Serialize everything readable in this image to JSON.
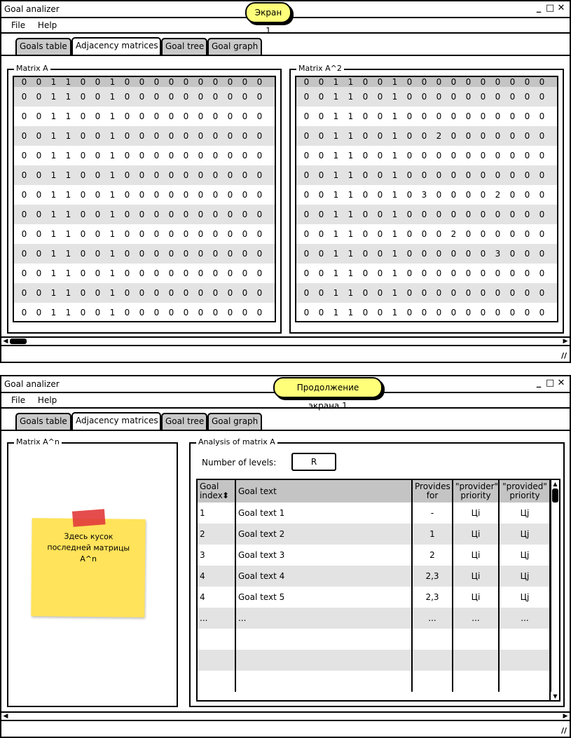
{
  "screen1": {
    "title": "Goal analizer",
    "sticky_label": "Экран 1",
    "controls": {
      "minimize": "_",
      "maximize": "□",
      "close": "✕"
    },
    "menu": {
      "file": "File",
      "help": "Help"
    },
    "tabs": [
      "Goals table",
      "Adjacency matrices",
      "Goal tree",
      "Goal graph"
    ],
    "matrix_a": {
      "legend": "Matrix A",
      "rows": [
        [
          "0",
          "0",
          "1",
          "1",
          "0",
          "0",
          "1",
          "0",
          "0",
          "0",
          "0",
          "0",
          "0",
          "0",
          "0",
          "0",
          "0"
        ],
        [
          "0",
          "0",
          "1",
          "1",
          "0",
          "0",
          "1",
          "0",
          "0",
          "0",
          "0",
          "0",
          "0",
          "0",
          "0",
          "0",
          "0"
        ],
        [
          "0",
          "0",
          "1",
          "1",
          "0",
          "0",
          "1",
          "0",
          "0",
          "0",
          "0",
          "0",
          "0",
          "0",
          "0",
          "0",
          "0"
        ],
        [
          "0",
          "0",
          "1",
          "1",
          "0",
          "0",
          "1",
          "0",
          "0",
          "0",
          "0",
          "0",
          "0",
          "0",
          "0",
          "0",
          "0"
        ],
        [
          "0",
          "0",
          "1",
          "1",
          "0",
          "0",
          "1",
          "0",
          "0",
          "0",
          "0",
          "0",
          "0",
          "0",
          "0",
          "0",
          "0"
        ],
        [
          "0",
          "0",
          "1",
          "1",
          "0",
          "0",
          "1",
          "0",
          "0",
          "0",
          "0",
          "0",
          "0",
          "0",
          "0",
          "0",
          "0"
        ],
        [
          "0",
          "0",
          "1",
          "1",
          "0",
          "0",
          "1",
          "0",
          "0",
          "0",
          "0",
          "0",
          "0",
          "0",
          "0",
          "0",
          "0"
        ],
        [
          "0",
          "0",
          "1",
          "1",
          "0",
          "0",
          "1",
          "0",
          "0",
          "0",
          "0",
          "0",
          "0",
          "0",
          "0",
          "0",
          "0"
        ],
        [
          "0",
          "0",
          "1",
          "1",
          "0",
          "0",
          "1",
          "0",
          "0",
          "0",
          "0",
          "0",
          "0",
          "0",
          "0",
          "0",
          "0"
        ],
        [
          "0",
          "0",
          "1",
          "1",
          "0",
          "0",
          "1",
          "0",
          "0",
          "0",
          "0",
          "0",
          "0",
          "0",
          "0",
          "0",
          "0"
        ],
        [
          "0",
          "0",
          "1",
          "1",
          "0",
          "0",
          "1",
          "0",
          "0",
          "0",
          "0",
          "0",
          "0",
          "0",
          "0",
          "0",
          "0"
        ],
        [
          "0",
          "0",
          "1",
          "1",
          "0",
          "0",
          "1",
          "0",
          "0",
          "0",
          "0",
          "0",
          "0",
          "0",
          "0",
          "0",
          "0"
        ],
        [
          "0",
          "0",
          "1",
          "1",
          "0",
          "0",
          "1",
          "0",
          "0",
          "0",
          "0",
          "0",
          "0",
          "0",
          "0",
          "0",
          "0"
        ]
      ]
    },
    "matrix_a2": {
      "legend": "Matrix A^2",
      "rows": [
        [
          "0",
          "0",
          "1",
          "1",
          "0",
          "0",
          "1",
          "0",
          "0",
          "0",
          "0",
          "0",
          "0",
          "0",
          "0",
          "0",
          "0"
        ],
        [
          "0",
          "0",
          "1",
          "1",
          "0",
          "0",
          "1",
          "0",
          "0",
          "0",
          "0",
          "0",
          "0",
          "0",
          "0",
          "0",
          "0"
        ],
        [
          "0",
          "0",
          "1",
          "1",
          "0",
          "0",
          "1",
          "0",
          "0",
          "0",
          "0",
          "0",
          "0",
          "0",
          "0",
          "0",
          "0"
        ],
        [
          "0",
          "0",
          "1",
          "1",
          "0",
          "0",
          "1",
          "0",
          "0",
          "2",
          "0",
          "0",
          "0",
          "0",
          "0",
          "0",
          "0"
        ],
        [
          "0",
          "0",
          "1",
          "1",
          "0",
          "0",
          "1",
          "0",
          "0",
          "0",
          "0",
          "0",
          "0",
          "0",
          "0",
          "0",
          "0"
        ],
        [
          "0",
          "0",
          "1",
          "1",
          "0",
          "0",
          "1",
          "0",
          "0",
          "0",
          "0",
          "0",
          "0",
          "0",
          "0",
          "0",
          "0"
        ],
        [
          "0",
          "0",
          "1",
          "1",
          "0",
          "0",
          "1",
          "0",
          "3",
          "0",
          "0",
          "0",
          "0",
          "2",
          "0",
          "0",
          "0"
        ],
        [
          "0",
          "0",
          "1",
          "1",
          "0",
          "0",
          "1",
          "0",
          "0",
          "0",
          "0",
          "0",
          "0",
          "0",
          "0",
          "0",
          "0"
        ],
        [
          "0",
          "0",
          "1",
          "1",
          "0",
          "0",
          "1",
          "0",
          "0",
          "0",
          "2",
          "0",
          "0",
          "0",
          "0",
          "0",
          "0"
        ],
        [
          "0",
          "0",
          "1",
          "1",
          "0",
          "0",
          "1",
          "0",
          "0",
          "0",
          "0",
          "0",
          "0",
          "3",
          "0",
          "0",
          "0"
        ],
        [
          "0",
          "0",
          "1",
          "1",
          "0",
          "0",
          "1",
          "0",
          "0",
          "0",
          "0",
          "0",
          "0",
          "0",
          "0",
          "0",
          "0"
        ],
        [
          "0",
          "0",
          "1",
          "1",
          "0",
          "0",
          "1",
          "0",
          "0",
          "0",
          "0",
          "0",
          "0",
          "0",
          "0",
          "0",
          "0"
        ],
        [
          "0",
          "0",
          "1",
          "1",
          "0",
          "0",
          "1",
          "0",
          "0",
          "0",
          "0",
          "0",
          "0",
          "0",
          "0",
          "0",
          "0"
        ]
      ]
    }
  },
  "screen2": {
    "title": "Goal analizer",
    "sticky_label": "Продолжение экрана 1",
    "controls": {
      "minimize": "_",
      "maximize": "□",
      "close": "✕"
    },
    "menu": {
      "file": "File",
      "help": "Help"
    },
    "tabs": [
      "Goals table",
      "Adjacency matrices",
      "Goal tree",
      "Goal graph"
    ],
    "matrix_an": {
      "legend": "Matrix A^n",
      "note": "Здесь кусок последней матрицы A^n"
    },
    "analysis": {
      "legend": "Analysis of matrix A",
      "levels_label": "Number of levels:",
      "levels_value": "R",
      "columns": [
        "Goal index",
        "Goal text",
        "Provides for",
        "\"provider\" priority",
        "\"provided\" priority"
      ],
      "rows": [
        [
          "1",
          "Goal text 1",
          "-",
          "Цi",
          "Цj"
        ],
        [
          "2",
          "Goal text 2",
          "1",
          "Цi",
          "Цj"
        ],
        [
          "3",
          "Goal text 3",
          "2",
          "Цi",
          "Цj"
        ],
        [
          "4",
          "Goal text 4",
          "2,3",
          "Цi",
          "Цj"
        ],
        [
          "4",
          "Goal text 5",
          "2,3",
          "Цi",
          "Цj"
        ],
        [
          "...",
          "...",
          "...",
          "...",
          "..."
        ],
        [
          "",
          "",
          "",
          "",
          ""
        ],
        [
          "",
          "",
          "",
          "",
          ""
        ],
        [
          "",
          "",
          "",
          "",
          ""
        ]
      ]
    }
  }
}
